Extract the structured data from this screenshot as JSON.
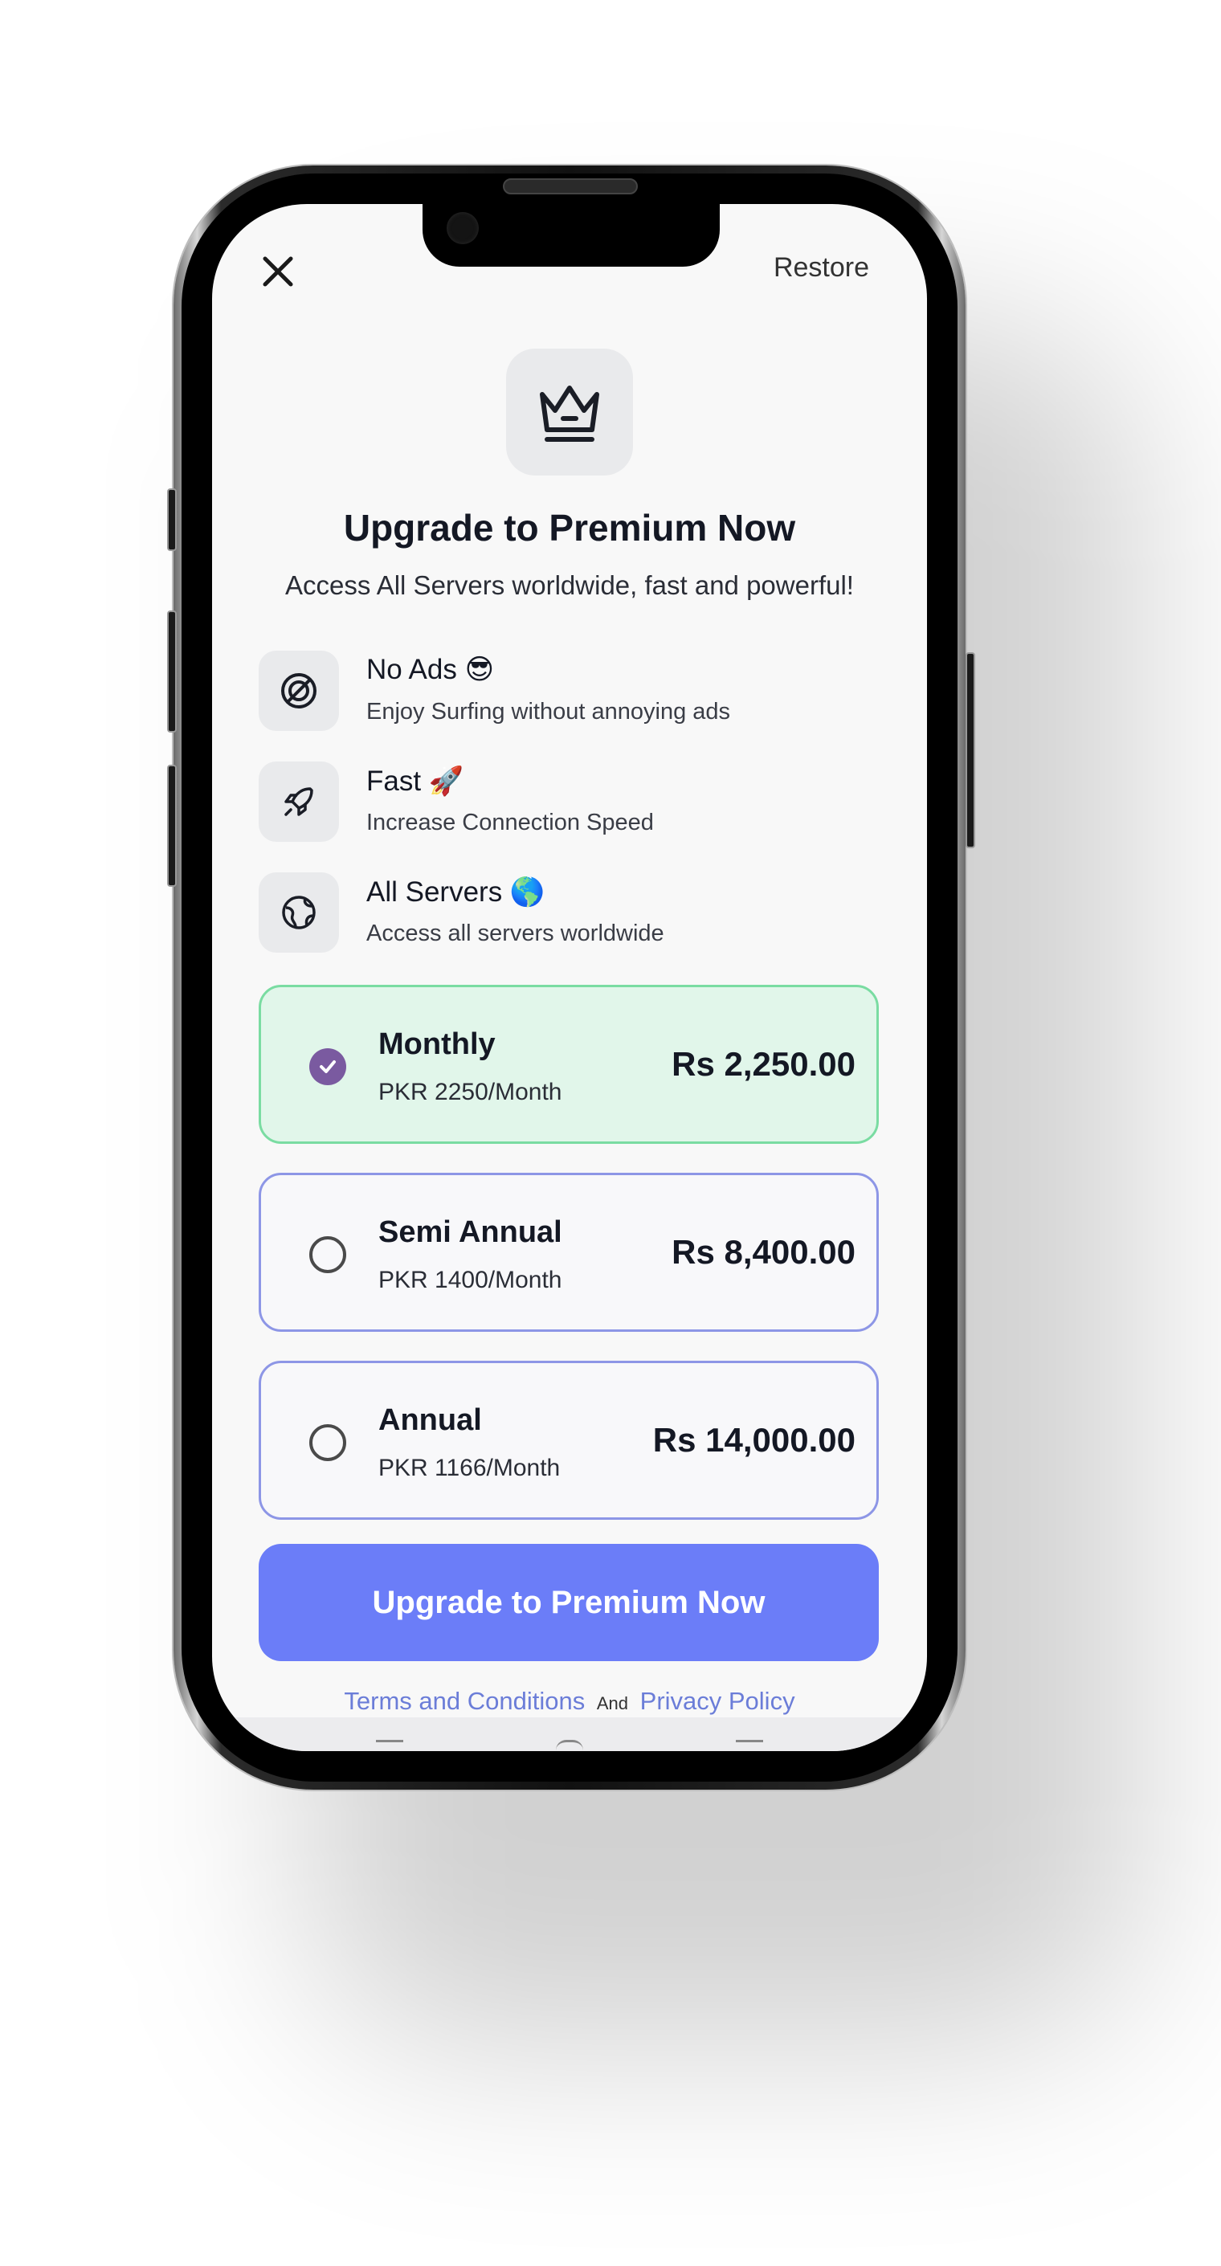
{
  "header": {
    "close_icon": "close-icon",
    "restore_label": "Restore"
  },
  "hero": {
    "icon": "crown-icon",
    "title": "Upgrade to Premium Now",
    "subtitle": "Access All Servers worldwide, fast and powerful!"
  },
  "features": [
    {
      "icon": "no-ads-icon",
      "title": "No Ads 😎",
      "description": "Enjoy Surfing without annoying ads"
    },
    {
      "icon": "rocket-icon",
      "title": "Fast  🚀",
      "description": "Increase Connection Speed"
    },
    {
      "icon": "globe-icon",
      "title": "All Servers 🌎",
      "description": "Access all servers worldwide"
    }
  ],
  "plans": [
    {
      "name": "Monthly",
      "detail": "PKR 2250/Month",
      "price": "Rs 2,250.00",
      "selected": true
    },
    {
      "name": "Semi Annual",
      "detail": "PKR 1400/Month",
      "price": "Rs 8,400.00",
      "selected": false
    },
    {
      "name": "Annual",
      "detail": "PKR 1166/Month",
      "price": "Rs 14,000.00",
      "selected": false
    }
  ],
  "cta": {
    "label": "Upgrade to Premium Now"
  },
  "footer": {
    "terms_label": "Terms and Conditions",
    "and_label": "And",
    "privacy_label": "Privacy Policy"
  },
  "colors": {
    "accent": "#6b7df8",
    "selected_bg": "#e1f6ea",
    "selected_border": "#7adca2",
    "plan_border": "#8d96e6",
    "check": "#7a5aa0"
  }
}
